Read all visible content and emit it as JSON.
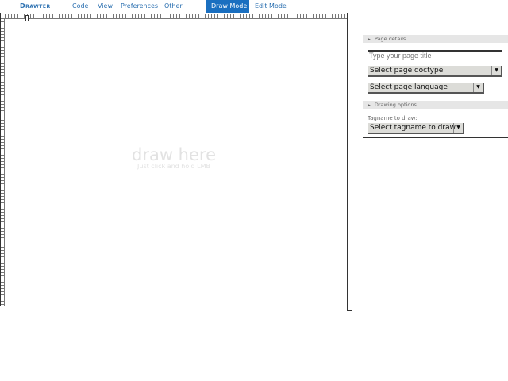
{
  "menu": {
    "brand": "Drawter",
    "items": [
      "Code",
      "View",
      "Preferences",
      "Other"
    ],
    "draw_mode": "Draw Mode",
    "edit_mode": "Edit Mode"
  },
  "canvas": {
    "hint_title": "draw here",
    "hint_subtitle": "Just click and hold LMB"
  },
  "sidebar": {
    "page_details": {
      "header": "Page details",
      "title_placeholder": "Type your page title",
      "doctype": "Select page doctype",
      "language": "Select page language"
    },
    "drawing_options": {
      "header": "Drawing options",
      "tagname_label": "Tagname to draw:",
      "tagname": "Select tagname to draw"
    }
  }
}
